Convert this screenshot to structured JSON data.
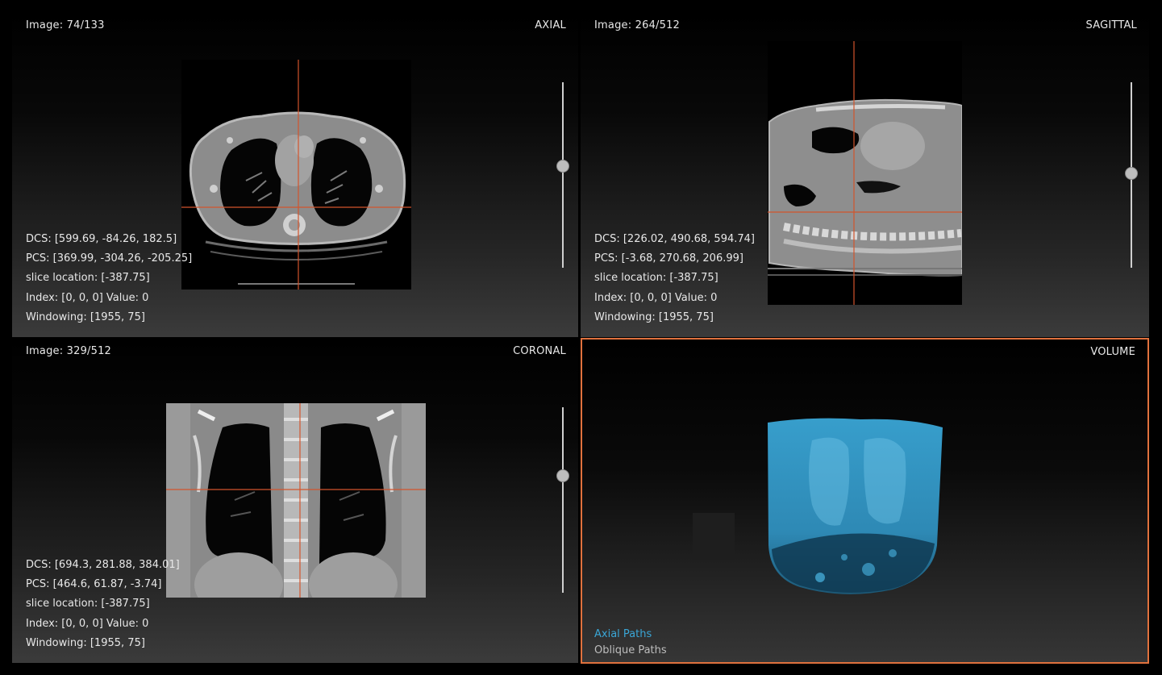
{
  "viewports": {
    "axial": {
      "image_counter": "Image: 74/133",
      "orientation": "AXIAL",
      "info": [
        "DCS: [599.69, -84.26, 182.5]",
        "PCS: [369.99, -304.26, -205.25]",
        "slice location: [-387.75]",
        "Index: [0, 0, 0] Value: 0",
        "Windowing: [1955, 75]"
      ],
      "slider_fraction": 0.45
    },
    "sagittal": {
      "image_counter": "Image: 264/512",
      "orientation": "SAGITTAL",
      "info": [
        "DCS: [226.02, 490.68, 594.74]",
        "PCS: [-3.68, 270.68, 206.99]",
        "slice location: [-387.75]",
        "Index: [0, 0, 0] Value: 0",
        "Windowing: [1955, 75]"
      ],
      "slider_fraction": 0.49
    },
    "coronal": {
      "image_counter": "Image: 329/512",
      "orientation": "CORONAL",
      "info": [
        "DCS: [694.3, 281.88, 384.01]",
        "PCS: [464.6, 61.87, -3.74]",
        "slice location: [-387.75]",
        "Index: [0, 0, 0] Value: 0",
        "Windowing: [1955, 75]"
      ],
      "slider_fraction": 0.33
    },
    "volume": {
      "orientation": "VOLUME",
      "legend": {
        "axial_paths": "Axial Paths",
        "oblique_paths": "Oblique Paths"
      }
    }
  },
  "colors": {
    "crosshair": "#d2542c",
    "active_border": "#e0713d",
    "volume_render": "#3aa6d6",
    "legend_active": "#3aa6d6"
  }
}
